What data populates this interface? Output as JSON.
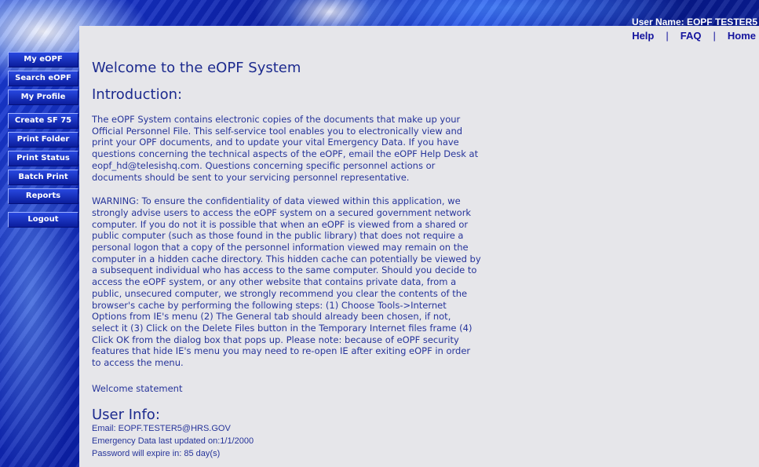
{
  "header": {
    "user_name": "User Name: EOPF TESTER5"
  },
  "top_links": {
    "help": "Help",
    "faq": "FAQ",
    "home": "Home",
    "separator": "|"
  },
  "nav": {
    "my_eopf": "My eOPF",
    "search_eopf": "Search eOPF",
    "my_profile": "My Profile",
    "create_sf75": "Create SF 75",
    "print_folder": "Print Folder",
    "print_status": "Print Status",
    "batch_print": "Batch Print",
    "reports": "Reports",
    "logout": "Logout"
  },
  "main": {
    "title": "Welcome to the eOPF System",
    "intro_heading": "Introduction:",
    "intro_lines": [
      "The eOPF System contains electronic copies of the documents that make up your",
      "Official Personnel File. This self-service tool enables you to electronically view and",
      "print your OPF documents, and to update your vital Emergency Data. If you have",
      "questions concerning the technical aspects of the eOPF, email the eOPF Help Desk at",
      "eopf_hd@telesishq.com. Questions concerning specific personnel actions or",
      "documents should be sent to your servicing personnel representative."
    ],
    "warning_lines": [
      "WARNING: To ensure the confidentiality of data viewed within this application, we",
      "strongly advise users to access the eOPF system on a secured government network",
      "computer. If you do not it is possible that when an eOPF is viewed from a shared or",
      "public computer (such as those found in the public library) that does not require a",
      "personal logon that a copy of the personnel information viewed may remain on the",
      "computer in a hidden cache directory. This hidden cache can potentially be viewed by",
      "a subsequent individual who has access to the same computer. Should you decide to",
      "access the eOPF system, or any other website that contains private data, from a",
      "public, unsecured computer, we strongly recommend you clear the contents of the",
      "browser's cache by performing the following steps: (1) Choose Tools->Internet",
      "Options from IE's menu (2) The General tab should already been chosen, if not,",
      "select it (3) Click on the Delete Files button in the Temporary Internet files frame (4)",
      "Click OK from the dialog box that pops up. Please note: because of eOPF security",
      "features that hide IE's menu you may need to re-open IE after exiting eOPF in order",
      "to access the menu."
    ],
    "welcome_statement": "Welcome statement",
    "user_info_heading": "User Info:",
    "email": "Email: EOPF.TESTER5@HRS.GOV",
    "emergency": "Emergency Data last updated on:1/1/2000",
    "password": "Password will expire in: 85 day(s)"
  }
}
